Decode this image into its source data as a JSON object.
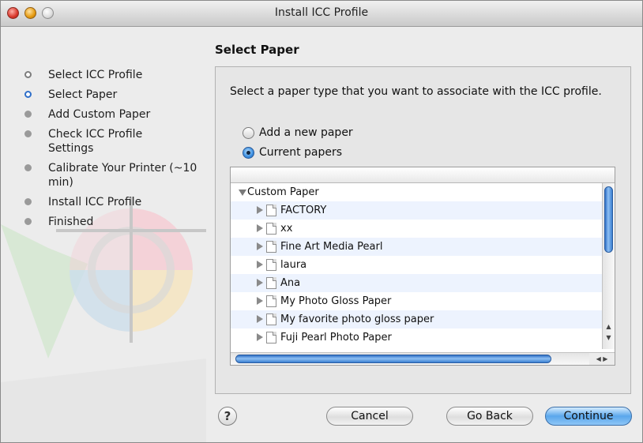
{
  "window": {
    "title": "Install ICC Profile"
  },
  "steps": [
    {
      "label": "Select ICC Profile",
      "state": "done"
    },
    {
      "label": "Select Paper",
      "state": "current"
    },
    {
      "label": "Add Custom Paper",
      "state": "pending"
    },
    {
      "label": "Check ICC Profile Settings",
      "state": "pending"
    },
    {
      "label": "Calibrate Your Printer (~10 min)",
      "state": "pending"
    },
    {
      "label": "Install ICC Profile",
      "state": "pending"
    },
    {
      "label": "Finished",
      "state": "pending"
    }
  ],
  "main": {
    "heading": "Select Paper",
    "description": "Select a paper type that you want to associate with the ICC profile.",
    "options": [
      {
        "label": "Add a new paper",
        "selected": false
      },
      {
        "label": "Current papers",
        "selected": true
      }
    ],
    "tree": {
      "root": "Custom Paper",
      "items": [
        "FACTORY",
        "xx",
        "Fine Art Media Pearl",
        "laura",
        "Ana",
        "My Photo Gloss Paper",
        "My favorite photo gloss paper",
        "Fuji Pearl Photo Paper"
      ]
    }
  },
  "buttons": {
    "help": "?",
    "cancel": "Cancel",
    "back": "Go Back",
    "continue": "Continue"
  },
  "colors": {
    "accent": "#3b8ee0",
    "row_alt": "#edf3fe"
  },
  "icons": {
    "step_bullet": "bullet-icon",
    "tree_expand": "disclosure-triangle-icon",
    "tree_item": "document-icon"
  }
}
